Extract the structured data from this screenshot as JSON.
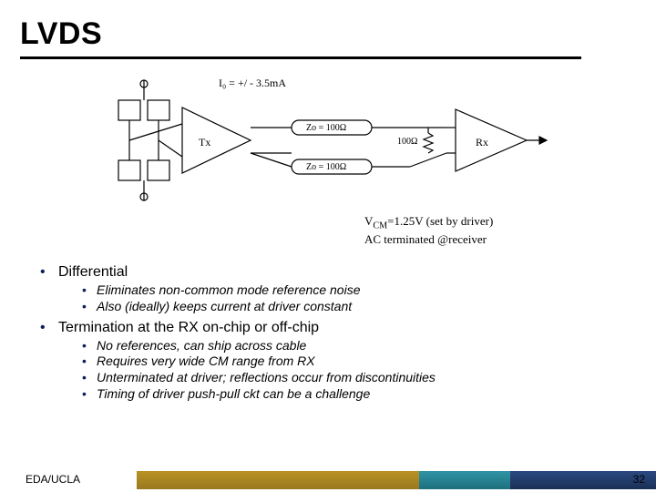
{
  "title": "LVDS",
  "diagram": {
    "io_label": "I₀ = +/ - 3.5mA",
    "tx_label": "Tx",
    "rx_label": "Rx",
    "zo_top": "Zo = 100Ω",
    "zo_bot": "Zo = 100Ω",
    "term_label": "100Ω"
  },
  "caption": {
    "line1_prefix": "V",
    "line1_sub": "CM",
    "line1_rest": "=1.25V (set by driver)",
    "line2": "AC terminated @receiver"
  },
  "bullets": {
    "b1": {
      "label": "Differential",
      "subs": [
        "Eliminates non-common mode reference noise",
        "Also (ideally) keeps current at driver constant"
      ]
    },
    "b2": {
      "label": "Termination at the RX on-chip or off-chip",
      "subs": [
        "No references, can ship across cable",
        "Requires very wide CM range from RX",
        "Unterminated at driver; reflections occur from discontinuities",
        "Timing of driver push-pull ckt can be a challenge"
      ]
    }
  },
  "footer": {
    "left": "EDA/UCLA",
    "page": "32"
  }
}
